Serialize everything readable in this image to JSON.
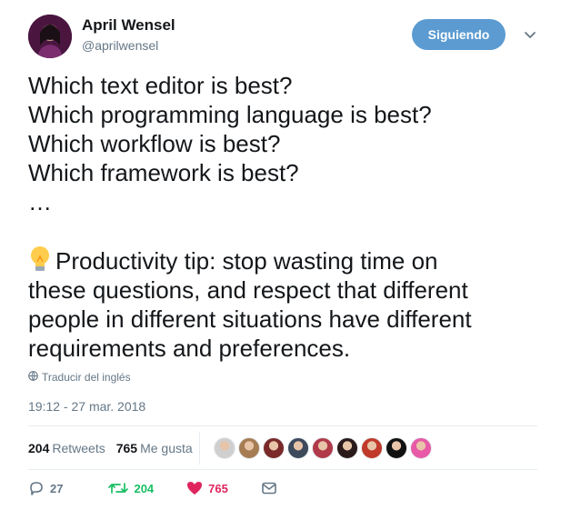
{
  "user": {
    "display_name": "April Wensel",
    "handle": "@aprilwensel",
    "follow_button": "Siguiendo"
  },
  "tweet": {
    "questions": [
      "Which text editor is best?",
      "Which programming language is best?",
      "Which workflow is best?",
      "Which framework is best?",
      "…"
    ],
    "tip_lines": [
      "Productivity tip: stop wasting time on",
      "these questions, and respect that different",
      "people in different situations have different",
      "requirements and preferences."
    ],
    "tip_emoji": "lightbulb-icon"
  },
  "translate_label": "Traducir del inglés",
  "timestamp": "19:12 - 27 mar. 2018",
  "stats": {
    "retweets_count": "204",
    "retweets_label": "Retweets",
    "likes_count": "765",
    "likes_label": "Me gusta"
  },
  "liker_colors": [
    "#cfcfcf",
    "#a67c52",
    "#7a2a2a",
    "#3d4a5c",
    "#b03a4a",
    "#2a1a1a",
    "#c0392b",
    "#111111",
    "#e85aa8"
  ],
  "actions": {
    "reply_count": "27",
    "retweet_count": "204",
    "like_count": "765"
  },
  "colors": {
    "follow_button_bg": "#5b9bd1",
    "retweet_green": "#17bf63",
    "like_red": "#e0245e",
    "muted_gray": "#657786"
  }
}
